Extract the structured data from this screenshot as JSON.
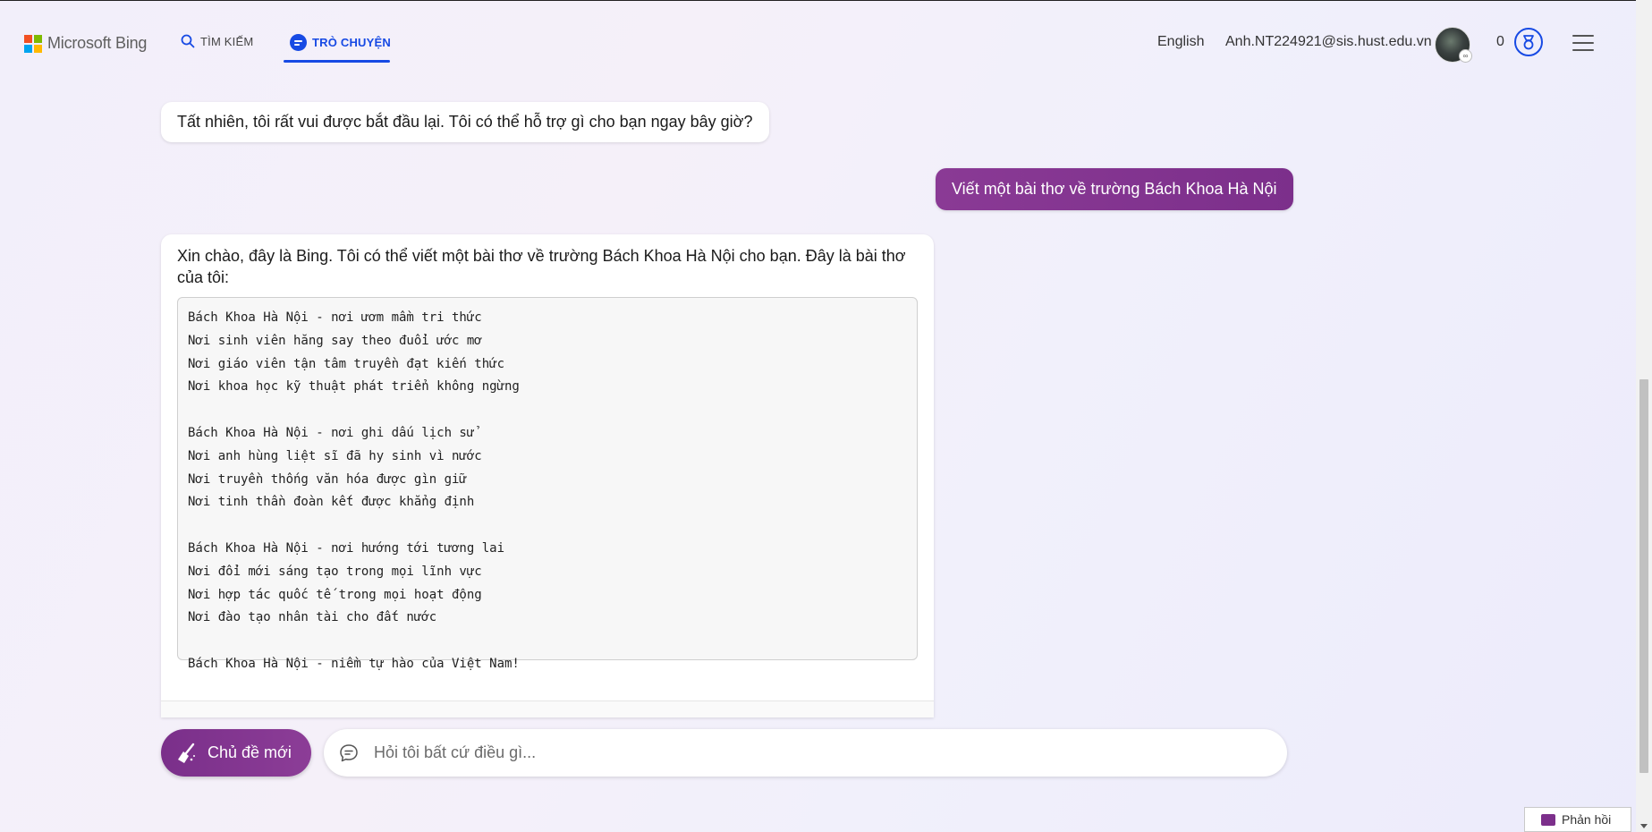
{
  "colors": {
    "accent_blue": "#174ae4",
    "user_bubble": "#8a3a95",
    "new_topic": "#7a2f8a",
    "ms_red": "#f25022",
    "ms_green": "#7fba00",
    "ms_blue": "#00a4ef",
    "ms_yellow": "#ffb900"
  },
  "header": {
    "logo_text": "Microsoft Bing",
    "nav": {
      "search_label": "TÌM KIẾM",
      "chat_label": "TRÒ CHUYỆN"
    },
    "language": "English",
    "user_email": "Anh.NT224921@sis.hust.edu.vn",
    "rewards_count": "0",
    "icons": [
      "search-icon",
      "chat-icon",
      "avatar",
      "rewards-medal-icon",
      "hamburger-menu-icon"
    ]
  },
  "conversation": {
    "msg1": "Tất nhiên, tôi rất vui được bắt đầu lại. Tôi có thể hỗ trợ gì cho bạn ngay bây giờ?",
    "user_msg": "Viết một bài thơ về trường Bách Khoa Hà Nội",
    "msg3_intro": "Xin chào, đây là Bing. Tôi có thể viết một bài thơ về trường Bách Khoa Hà Nội cho bạn. Đây là bài thơ của tôi:",
    "poem_lines": [
      "Bách Khoa Hà Nội - nơi ươm mầm tri thức",
      "Nơi sinh viên hăng say theo đuổi ước mơ",
      "Nơi giáo viên tận tâm truyền đạt kiến thức",
      "Nơi khoa học kỹ thuật phát triển không ngừng",
      "",
      "Bách Khoa Hà Nội - nơi ghi dấu lịch sử",
      "Nơi anh hùng liệt sĩ đã hy sinh vì nước",
      "Nơi truyền thống văn hóa được gìn giữ",
      "Nơi tinh thần đoàn kết được khẳng định",
      "",
      "Bách Khoa Hà Nội - nơi hướng tới tương lai",
      "Nơi đổi mới sáng tạo trong mọi lĩnh vực",
      "Nơi hợp tác quốc tế trong mọi hoạt động",
      "Nơi đào tạo nhân tài cho đất nước",
      "",
      "Bách Khoa Hà Nội - niềm tự hào của Việt Nam!"
    ]
  },
  "composer": {
    "new_topic_label": "Chủ đề mới",
    "input_placeholder": "Hỏi tôi bất cứ điều gì...",
    "input_value": ""
  },
  "feedback_label": "Phản hồi"
}
